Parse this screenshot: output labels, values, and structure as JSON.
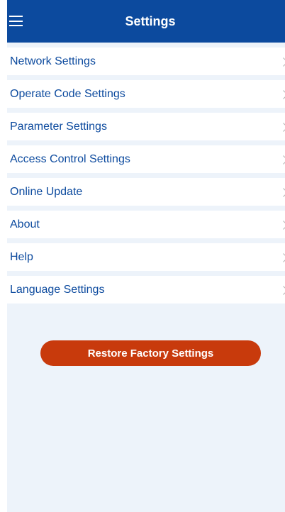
{
  "header": {
    "title": "Settings",
    "menu_icon": "hamburger-menu-icon"
  },
  "items": [
    {
      "label": "Network Settings",
      "icon": "chevron-right-icon"
    },
    {
      "label": "Operate Code Settings",
      "icon": "chevron-right-icon"
    },
    {
      "label": "Parameter Settings",
      "icon": "chevron-right-icon"
    },
    {
      "label": "Access Control Settings",
      "icon": "chevron-right-icon"
    },
    {
      "label": "Online Update",
      "icon": "chevron-right-icon"
    },
    {
      "label": "About",
      "icon": "chevron-right-icon"
    },
    {
      "label": "Help",
      "icon": "chevron-right-icon"
    },
    {
      "label": "Language Settings",
      "icon": "chevron-right-icon"
    }
  ],
  "restore_button": {
    "label": "Restore Factory Settings"
  },
  "colors": {
    "header_bg": "#0c4a9e",
    "page_bg": "#edf3fa",
    "item_text": "#0c4a9e",
    "restore_bg": "#c83a0c"
  }
}
